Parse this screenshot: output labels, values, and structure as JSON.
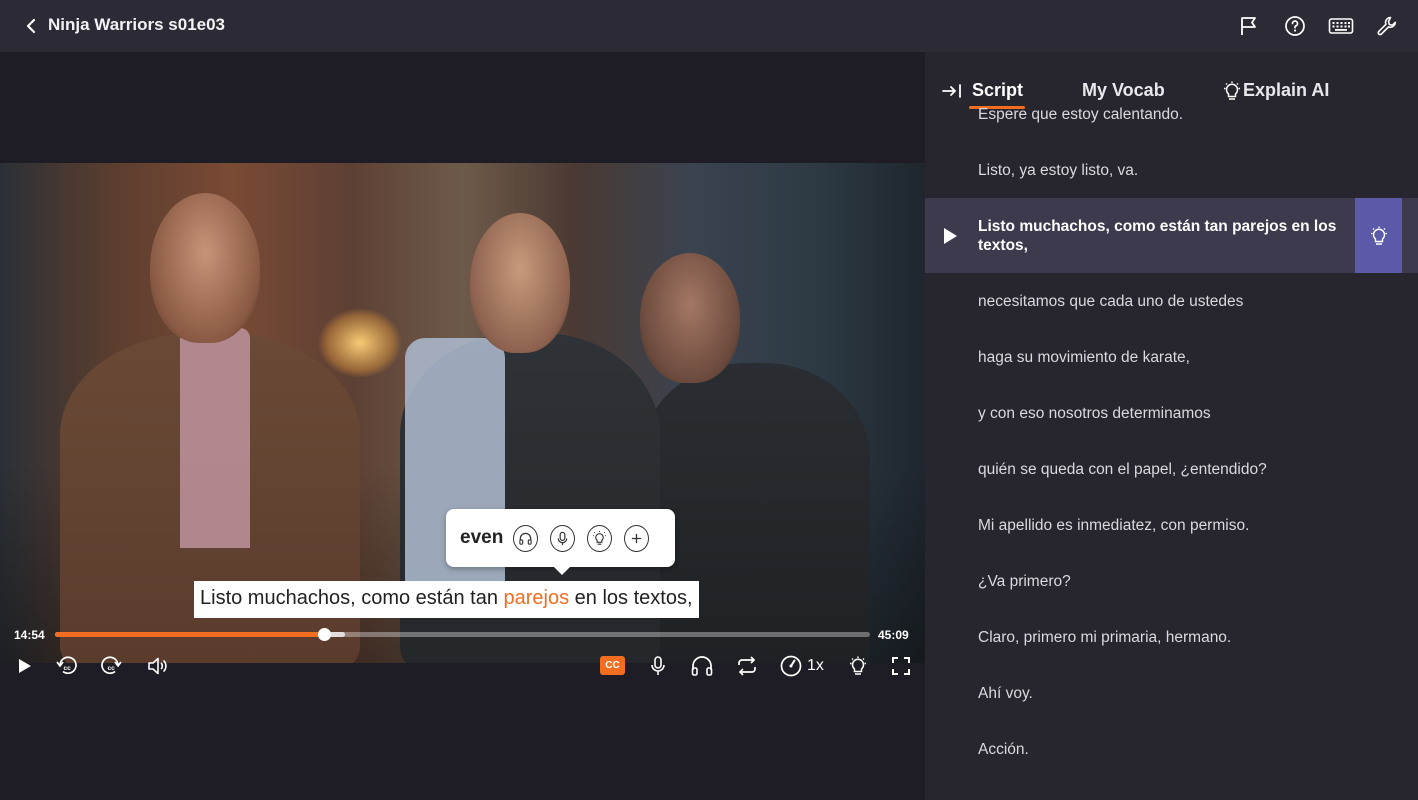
{
  "header": {
    "title": "Ninja Warriors s01e03",
    "icons": [
      "flag-icon",
      "help-icon",
      "keyboard-icon",
      "wrench-icon"
    ]
  },
  "player": {
    "popup": {
      "word": "even",
      "buttons": [
        "headphones-icon",
        "microphone-icon",
        "bulb-icon",
        "plus-icon"
      ]
    },
    "subtitle": {
      "before": "Listo muchachos, como están tan ",
      "highlight": "parejos",
      "after": " en los textos,"
    },
    "current_time": "14:54",
    "duration": "45:09",
    "progress": 0.33,
    "buffered": 0.356,
    "cc_label": "CC",
    "speed": "1x"
  },
  "sidebar": {
    "tabs": [
      {
        "label": "Script",
        "active": true
      },
      {
        "label": "My Vocab",
        "active": false
      },
      {
        "label": "Explain AI",
        "active": false
      }
    ],
    "lines": [
      "Espere que estoy calentando.",
      "Listo, ya estoy listo, va.",
      "Listo muchachos, como están tan parejos en los textos,",
      "necesitamos que cada uno de ustedes",
      "haga su movimiento de karate,",
      "y con eso nosotros determinamos",
      "quién se queda con el papel, ¿entendido?",
      "Mi apellido es inmediatez, con permiso.",
      "¿Va primero?",
      "Claro, primero mi primaria, hermano.",
      "Ahí voy.",
      "Acción."
    ],
    "active_index": 2
  },
  "colors": {
    "accent": "#f26d1f",
    "active_row": "#3d3a4d",
    "bulb_box": "#5b5aa8"
  }
}
